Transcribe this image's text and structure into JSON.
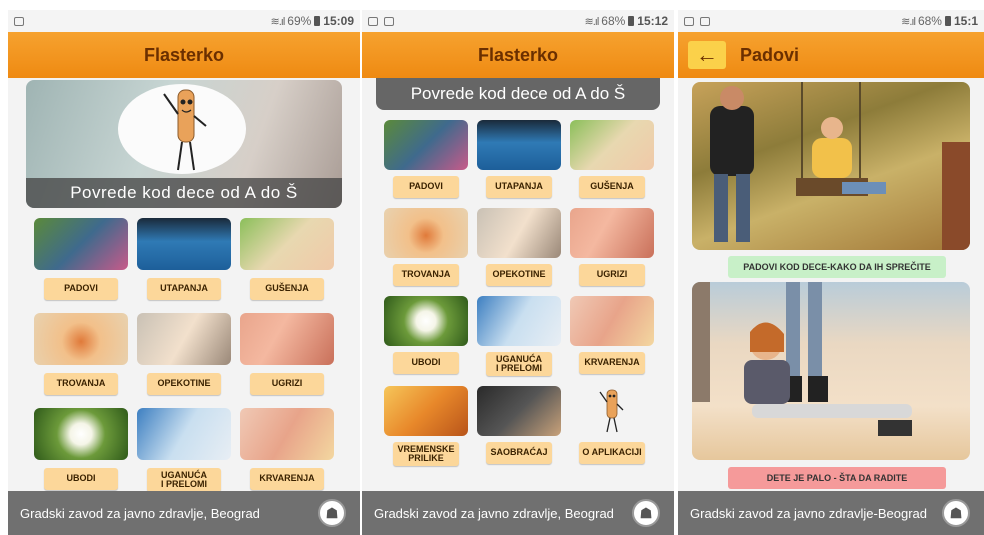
{
  "screens": [
    {
      "status": {
        "battery": "69%",
        "time": "15:09"
      },
      "app_title": "Flasterko",
      "hero_caption": "Povrede kod dece od A do Š",
      "tiles": [
        "PADOVI",
        "UTAPANJA",
        "GUŠENJA",
        "TROVANJA",
        "OPEKOTINE",
        "UGRIZI",
        "UBODI",
        "UGANUĆA\nI PRELOMI",
        "KRVARENJA"
      ],
      "footer": "Gradski zavod za javno zdravlje, Beograd"
    },
    {
      "status": {
        "battery": "68%",
        "time": "15:12"
      },
      "app_title": "Flasterko",
      "banner": "Povrede kod dece od A do Š",
      "tiles": [
        "PADOVI",
        "UTAPANJA",
        "GUŠENJA",
        "TROVANJA",
        "OPEKOTINE",
        "UGRIZI",
        "UBODI",
        "UGANUĆA\nI PRELOMI",
        "KRVARENJA",
        "VREMENSKE\nPRILIKE",
        "SAOBRAĆAJ",
        "O APLIKACIJI"
      ],
      "footer": "Gradski zavod za javno zdravlje, Beograd"
    },
    {
      "status": {
        "battery": "68%",
        "time": "15:1"
      },
      "app_title": "Padovi",
      "back_icon": "arrow-left-icon",
      "button_prevent": "PADOVI KOD DECE-KAKO DA IH SPREČITE",
      "button_action": "DETE JE PALO - ŠTA DA RADITE",
      "footer": "Gradski zavod za javno zdravlje-Beograd"
    }
  ],
  "colors": {
    "appbar": "#f39a22",
    "chip": "#fcd79a",
    "footer": "#707070",
    "green_button": "#c8f0c8",
    "red_button": "#f59a9a"
  },
  "icons": [
    "wifi-icon",
    "signal-icon",
    "battery-icon",
    "city-logo-icon"
  ]
}
